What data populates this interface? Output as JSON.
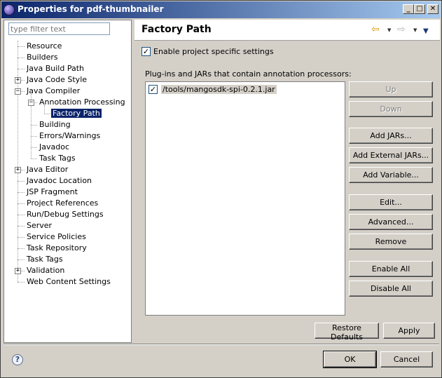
{
  "window": {
    "title": "Properties for pdf-thumbnailer"
  },
  "title_buttons": {
    "minimize": "_",
    "maximize": "□",
    "close": "✕"
  },
  "filter": {
    "placeholder": "type filter text"
  },
  "tree": {
    "items": [
      {
        "label": "Resource",
        "level": 0,
        "expander": ""
      },
      {
        "label": "Builders",
        "level": 0,
        "expander": ""
      },
      {
        "label": "Java Build Path",
        "level": 0,
        "expander": ""
      },
      {
        "label": "Java Code Style",
        "level": 0,
        "expander": "+"
      },
      {
        "label": "Java Compiler",
        "level": 0,
        "expander": "−"
      },
      {
        "label": "Annotation Processing",
        "level": 1,
        "expander": "−"
      },
      {
        "label": "Factory Path",
        "level": 2,
        "expander": "",
        "selected": true
      },
      {
        "label": "Building",
        "level": 1,
        "expander": ""
      },
      {
        "label": "Errors/Warnings",
        "level": 1,
        "expander": ""
      },
      {
        "label": "Javadoc",
        "level": 1,
        "expander": ""
      },
      {
        "label": "Task Tags",
        "level": 1,
        "expander": ""
      },
      {
        "label": "Java Editor",
        "level": 0,
        "expander": "+"
      },
      {
        "label": "Javadoc Location",
        "level": 0,
        "expander": ""
      },
      {
        "label": "JSP Fragment",
        "level": 0,
        "expander": ""
      },
      {
        "label": "Project References",
        "level": 0,
        "expander": ""
      },
      {
        "label": "Run/Debug Settings",
        "level": 0,
        "expander": ""
      },
      {
        "label": "Server",
        "level": 0,
        "expander": ""
      },
      {
        "label": "Service Policies",
        "level": 0,
        "expander": ""
      },
      {
        "label": "Task Repository",
        "level": 0,
        "expander": ""
      },
      {
        "label": "Task Tags",
        "level": 0,
        "expander": ""
      },
      {
        "label": "Validation",
        "level": 0,
        "expander": "+"
      },
      {
        "label": "Web Content Settings",
        "level": 0,
        "expander": ""
      }
    ]
  },
  "page": {
    "title": "Factory Path",
    "back_icon": "⇦",
    "forward_icon": "⇨",
    "menu_icon": "▼",
    "enable_label": "Enable project specific settings",
    "enable_checked": true,
    "list_label": "Plug-ins and JARs that contain annotation processors:",
    "jars": [
      {
        "path": "/tools/mangosdk-spi-0.2.1.jar",
        "checked": true
      }
    ]
  },
  "buttons": {
    "up": "Up",
    "down": "Down",
    "add_jars": "Add JARs...",
    "add_external_jars": "Add External JARs...",
    "add_variable": "Add Variable...",
    "edit": "Edit...",
    "advanced": "Advanced...",
    "remove": "Remove",
    "enable_all": "Enable All",
    "disable_all": "Disable All",
    "restore_defaults": "Restore Defaults",
    "apply": "Apply",
    "ok": "OK",
    "cancel": "Cancel"
  },
  "help_icon": "?",
  "colors": {
    "selection": "#0a246a",
    "title_start": "#0a246a",
    "title_end": "#a6caf0"
  }
}
